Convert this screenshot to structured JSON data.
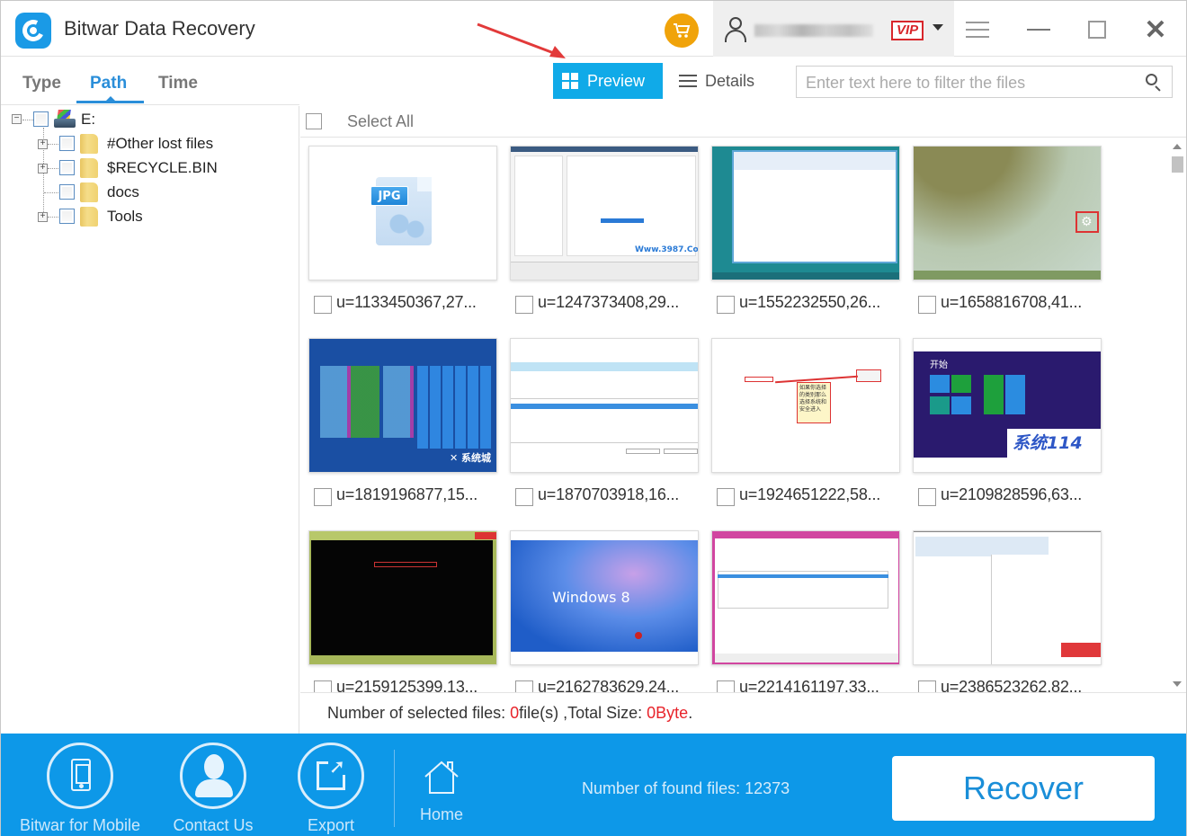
{
  "window": {
    "title": "Bitwar Data Recovery",
    "vip_label": "VIP",
    "colors": {
      "accent": "#10aae8",
      "bottom_bar": "#0d98e8",
      "tab_active": "#2a8ed9",
      "cart": "#f0a30a",
      "vip": "#d8262b",
      "highlight_red": "#e8232a"
    }
  },
  "left_tabs": {
    "items": [
      {
        "label": "Type",
        "active": false
      },
      {
        "label": "Path",
        "active": true
      },
      {
        "label": "Time",
        "active": false
      }
    ]
  },
  "view_toolbar": {
    "preview_label": "Preview",
    "details_label": "Details",
    "active_view": "Preview",
    "filter_placeholder": "Enter text here to filter the files",
    "filter_value": ""
  },
  "tree": {
    "root": {
      "label": "E:",
      "expanded": true,
      "checked": false
    },
    "children": [
      {
        "label": "#Other lost files",
        "expandable": true,
        "checked": false
      },
      {
        "label": "$RECYCLE.BIN",
        "expandable": true,
        "checked": false
      },
      {
        "label": "docs",
        "expandable": false,
        "checked": false
      },
      {
        "label": "Tools",
        "expandable": true,
        "checked": false
      }
    ]
  },
  "grid": {
    "select_all_label": "Select All",
    "files": [
      {
        "name": "u=1133450367,27...",
        "preview": "jpg-placeholder",
        "checked": false
      },
      {
        "name": "u=1247373408,29...",
        "preview": "settings-dialog",
        "checked": false
      },
      {
        "name": "u=1552232550,26...",
        "preview": "explorer-desktop",
        "checked": false
      },
      {
        "name": "u=1658816708,41...",
        "preview": "charms-bar",
        "checked": false
      },
      {
        "name": "u=1819196877,15...",
        "preview": "win8-start-tiles",
        "checked": false
      },
      {
        "name": "u=1870703918,16...",
        "preview": "optimize-drives",
        "checked": false
      },
      {
        "name": "u=1924651222,58...",
        "preview": "control-panel-annotated",
        "checked": false
      },
      {
        "name": "u=2109828596,63...",
        "preview": "win8-start-purple",
        "checked": false
      },
      {
        "name": "u=2159125399,13...",
        "preview": "command-prompt",
        "checked": false
      },
      {
        "name": "u=2162783629,24...",
        "preview": "windows-8-wallpaper",
        "checked": false
      },
      {
        "name": "u=2214161197,33...",
        "preview": "optimize-drives-pink",
        "checked": false
      },
      {
        "name": "u=2386523262,82...",
        "preview": "drive-context-menu",
        "checked": false
      }
    ],
    "thumb_texts": {
      "jpg_tag": "JPG",
      "win8_logo_text": "Windows 8",
      "start_label": "开始",
      "brand_114": "系统114",
      "annotation_note": "如果你选择的类别那么选择系统和安全进入"
    }
  },
  "status": {
    "prefix": "Number of selected files: ",
    "selected_count": "0",
    "files_unit": "file(s) ,Total Size: ",
    "total_size": "0Byte",
    "suffix": "."
  },
  "bottom_bar": {
    "buttons": [
      {
        "label": "Bitwar for Mobile",
        "icon": "phone-icon"
      },
      {
        "label": "Contact Us",
        "icon": "person-icon"
      },
      {
        "label": "Export",
        "icon": "export-icon"
      },
      {
        "label": "Home",
        "icon": "home-icon"
      }
    ],
    "found_files_label": "Number of found files: 12373",
    "recover_label": "Recover"
  }
}
